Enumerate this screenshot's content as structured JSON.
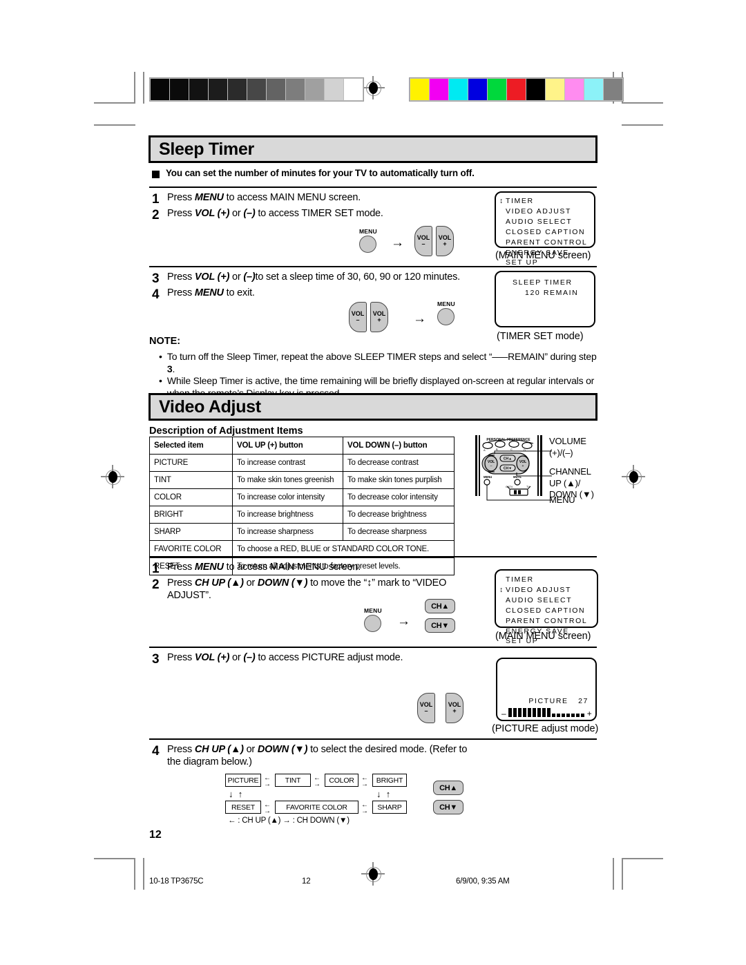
{
  "page": {
    "number": "12",
    "footer": {
      "left": "10-18 TP3675C",
      "center": "12",
      "right": "6/9/00, 9:35 AM"
    }
  },
  "calibration": {
    "grayscale_swatches": [
      "#070707",
      "#0b0b0b",
      "#121212",
      "#1c1c1c",
      "#2b2b2b",
      "#474747",
      "#636363",
      "#7d7d7d",
      "#a0a0a0",
      "#d2d2d2",
      "#ffffff"
    ],
    "color_swatches": [
      "#fff200",
      "#f200f2",
      "#00eaf2",
      "#0000e0",
      "#00d83c",
      "#ed1c24",
      "#000000",
      "#fff389",
      "#ff8cf0",
      "#8cf2f8",
      "#808080"
    ]
  },
  "sleep_timer": {
    "heading": "Sleep Timer",
    "intro": "You can set the number of minutes for your TV to automatically turn off.",
    "steps": [
      {
        "num": "1",
        "text_html": "Press <i>MENU</i> to access MAIN MENU screen."
      },
      {
        "num": "2",
        "text_html": "Press <i>VOL (+)</i> or <i>(&ndash;)</i> to access TIMER SET mode."
      },
      {
        "num": "3",
        "text_html": "Press <i>VOL (+)</i> or <i>(&ndash;)</i>to set a sleep time of 30, 60, 90 or 120 minutes."
      },
      {
        "num": "4",
        "text_html": "Press <i>MENU</i> to exit."
      }
    ],
    "buttons": {
      "menu": "MENU",
      "vol_minus_top": "VOL",
      "vol_minus_sign": "–",
      "vol_plus_top": "VOL",
      "vol_plus_sign": "+",
      "arrow": "→"
    },
    "main_menu_screen": {
      "caption": "(MAIN MENU screen)",
      "marker": "↕",
      "selected_index": 0,
      "items": [
        "TIMER",
        "VIDEO ADJUST",
        "AUDIO SELECT",
        "CLOSED CAPTION",
        "PARENT CONTROL",
        "ENERGY SAVE",
        "SET UP"
      ]
    },
    "timer_set_screen": {
      "caption": "(TIMER SET mode)",
      "line1": "SLEEP TIMER",
      "line2": "120 REMAIN"
    },
    "note": {
      "title": "NOTE:",
      "items_html": [
        "To turn off the Sleep Timer, repeat the above SLEEP TIMER steps and select “–––REMAIN” during step <b>3</b>.",
        "While Sleep Timer is active, the time remaining will be briefly displayed on-screen at regular intervals or when the remote’s Display key is pressed."
      ]
    }
  },
  "video_adjust": {
    "heading": "Video Adjust",
    "table_title": "Description of Adjustment Items",
    "table": {
      "headers": [
        "Selected item",
        "VOL UP (+) button",
        "VOL DOWN (–) button"
      ],
      "rows": [
        {
          "item": "PICTURE",
          "up": "To increase contrast",
          "down": "To decrease contrast",
          "span": false
        },
        {
          "item": "TINT",
          "up": "To make skin tones greenish",
          "down": "To make skin tones purplish",
          "span": false
        },
        {
          "item": "COLOR",
          "up": "To increase color intensity",
          "down": "To decrease color intensity",
          "span": false
        },
        {
          "item": "BRIGHT",
          "up": "To increase brightness",
          "down": "To decrease brightness",
          "span": false
        },
        {
          "item": "SHARP",
          "up": "To increase sharpness",
          "down": "To decrease sharpness",
          "span": false
        },
        {
          "item": "FAVORITE COLOR",
          "up": "To choose a RED, BLUE or STANDARD COLOR TONE.",
          "down": "",
          "span": true
        },
        {
          "item": "RESET",
          "up": "To return all adjustments to factory preset levels.",
          "down": "",
          "span": true
        }
      ]
    },
    "remote": {
      "personal_preference_label": "PERSONAL PREFERENCE",
      "pp_keys": [
        "A",
        "B",
        "C",
        "D"
      ],
      "vol_left": "VOL",
      "vol_left_sign": "–",
      "vol_right": "VOL",
      "vol_right_sign": "+",
      "ch_up": "CH▲",
      "ch_down": "CH▼",
      "menu": "MENU",
      "mute": "MUTE",
      "catv": "CATV",
      "tv": "TV",
      "callouts": {
        "volume": "VOLUME\n(+)/(–)",
        "channel": "CHANNEL\nUP (▲)/\nDOWN (▼)",
        "menu": "MENU"
      }
    },
    "steps": [
      {
        "num": "1",
        "text_html": "Press <i>MENU</i> to access MAIN MENU screen."
      },
      {
        "num": "2",
        "text_html": "Press <i>CH UP (▲)</i> or <i>DOWN (▼)</i> to move the “<b>↕</b>” mark to “VIDEO ADJUST”."
      },
      {
        "num": "3",
        "text_html": "Press <i>VOL (+)</i> or <i>(–)</i> to access PICTURE adjust mode."
      },
      {
        "num": "4",
        "text_html": "Press <i>CH UP (▲)</i> or <i>DOWN (▼)</i> to select the desired mode. (Refer to the diagram below.)"
      }
    ],
    "buttons": {
      "menu": "MENU",
      "arrow": "→",
      "ch_up": "CH▲",
      "ch_down": "CH▼",
      "vol_minus_top": "VOL",
      "vol_minus_sign": "–",
      "vol_plus_top": "VOL",
      "vol_plus_sign": "+"
    },
    "main_menu_screen": {
      "caption": "(MAIN MENU screen)",
      "marker": "↕",
      "selected_index": 1,
      "items": [
        "TIMER",
        "VIDEO ADJUST",
        "AUDIO SELECT",
        "CLOSED CAPTION",
        "PARENT CONTROL",
        "ENERGY SAVE",
        "SET UP"
      ]
    },
    "picture_screen": {
      "caption": "(PICTURE adjust mode)",
      "label": "PICTURE",
      "value": "27",
      "bar": {
        "minus": "–",
        "plus": "+",
        "filled": 9,
        "empty": 7
      }
    },
    "flow": {
      "row1": [
        "PICTURE",
        "TINT",
        "COLOR",
        "BRIGHT"
      ],
      "row2": [
        "RESET",
        "FAVORITE COLOR",
        "SHARP"
      ],
      "legend": "← : CH UP (▲)    → : CH DOWN (▼)",
      "ch_up": "CH▲",
      "ch_down": "CH▼"
    }
  }
}
